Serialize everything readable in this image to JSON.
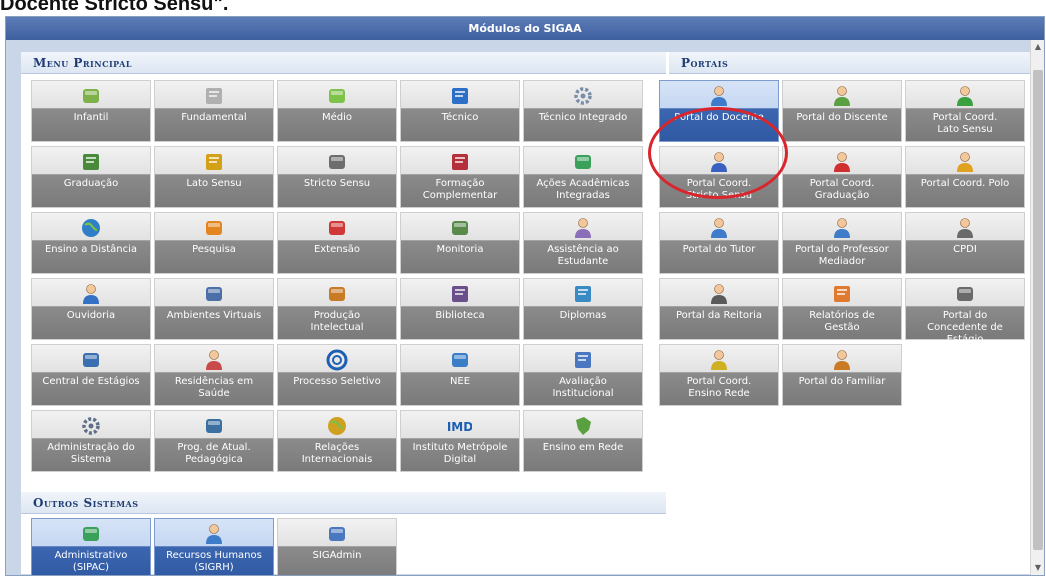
{
  "caption": "Docente Stricto Sensu\".",
  "window": {
    "title": "Módulos do SIGAA"
  },
  "sections": {
    "menu_principal": "Menu Principal",
    "portais": "Portais",
    "outros_sistemas": "Outros Sistemas"
  },
  "menu": [
    {
      "label": "Infantil",
      "icon": "pencil-cup-icon",
      "color": "#7fb14a"
    },
    {
      "label": "Fundamental",
      "icon": "notebook-icon",
      "color": "#b0b0b0"
    },
    {
      "label": "Médio",
      "icon": "crayon-icon",
      "color": "#7fc24a"
    },
    {
      "label": "Técnico",
      "icon": "book-icon",
      "color": "#2d6fc7"
    },
    {
      "label": "Técnico Integrado",
      "icon": "tools-icon",
      "color": "#7a8da8"
    },
    {
      "label": "Graduação",
      "icon": "books-icon",
      "color": "#4a8a3c"
    },
    {
      "label": "Lato Sensu",
      "icon": "folder-icon",
      "color": "#d4a017"
    },
    {
      "label": "Stricto Sensu",
      "icon": "briefcase-icon",
      "color": "#6d6d6d"
    },
    {
      "label": "Formação\nComplementar",
      "icon": "red-book-icon",
      "color": "#b3303a"
    },
    {
      "label": "Ações Acadêmicas\nIntegradas",
      "icon": "puzzle-icon",
      "color": "#3aa05a"
    },
    {
      "label": "Ensino a Distância",
      "icon": "globe-icon",
      "color": "#2e7fc8"
    },
    {
      "label": "Pesquisa",
      "icon": "flask-icon",
      "color": "#e3861f"
    },
    {
      "label": "Extensão",
      "icon": "gift-icon",
      "color": "#d03838"
    },
    {
      "label": "Monitoria",
      "icon": "easel-icon",
      "color": "#5a8a4a"
    },
    {
      "label": "Assistência ao\nEstudante",
      "icon": "student-help-icon",
      "color": "#8a6fb8"
    },
    {
      "label": "Ouvidoria",
      "icon": "person-icon",
      "color": "#3470c4"
    },
    {
      "label": "Ambientes Virtuais",
      "icon": "network-icon",
      "color": "#4c6fa8"
    },
    {
      "label": "Produção\nIntelectual",
      "icon": "author-icon",
      "color": "#c87a24"
    },
    {
      "label": "Biblioteca",
      "icon": "open-book-icon",
      "color": "#6a4f8a"
    },
    {
      "label": "Diplomas",
      "icon": "diploma-icon",
      "color": "#3a8ac4"
    },
    {
      "label": "Central de Estágios",
      "icon": "id-card-icon",
      "color": "#3a6fb0"
    },
    {
      "label": "Residências em\nSaúde",
      "icon": "doctor-icon",
      "color": "#c84a4a"
    },
    {
      "label": "Processo Seletivo",
      "icon": "c-logo-icon",
      "color": "#1e5fb3"
    },
    {
      "label": "NEE",
      "icon": "accessibility-icon",
      "color": "#3a7ec8"
    },
    {
      "label": "Avaliação\nInstitucional",
      "icon": "evaluation-icon",
      "color": "#4a78c0"
    },
    {
      "label": "Administração do\nSistema",
      "icon": "gears-icon",
      "color": "#5f6f88"
    },
    {
      "label": "Prog. de Atual.\nPedagógica",
      "icon": "presentation-icon",
      "color": "#3a6fa0"
    },
    {
      "label": "Relações\nInternacionais",
      "icon": "globe-hand-icon",
      "color": "#d0a020"
    },
    {
      "label": "Instituto Metrópole\nDigital",
      "icon": "imd-logo-icon",
      "color": "#1d5fb0",
      "text": "IMD"
    },
    {
      "label": "Ensino em Rede",
      "icon": "map-brazil-icon",
      "color": "#5aa040"
    }
  ],
  "portais": [
    {
      "label": "Portal do Docente",
      "icon": "teacher-icon",
      "color": "#3e7cc9",
      "selected": true
    },
    {
      "label": "Portal do Discente",
      "icon": "student-icon",
      "color": "#5aa040"
    },
    {
      "label": "Portal Coord.\nLato Sensu",
      "icon": "coord-lato-icon",
      "color": "#3aa040"
    },
    {
      "label": "Portal Coord.\nStricto Sensu",
      "icon": "coord-stricto-icon",
      "color": "#3a60c0"
    },
    {
      "label": "Portal Coord.\nGraduação",
      "icon": "coord-grad-icon",
      "color": "#d03030"
    },
    {
      "label": "Portal Coord. Polo",
      "icon": "coord-polo-icon",
      "color": "#e0a020"
    },
    {
      "label": "Portal do Tutor",
      "icon": "tutor-icon",
      "color": "#3e7cc9"
    },
    {
      "label": "Portal do Professor\nMediador",
      "icon": "mediator-icon",
      "color": "#3e7cc9"
    },
    {
      "label": "CPDI",
      "icon": "cpdi-icon",
      "color": "#6a6a6a"
    },
    {
      "label": "Portal da Reitoria",
      "icon": "reitoria-icon",
      "color": "#5a5a5a"
    },
    {
      "label": "Relatórios de\nGestão",
      "icon": "reports-icon",
      "color": "#e07a30"
    },
    {
      "label": "Portal do\nConcedente de\nEstágio",
      "icon": "concedente-icon",
      "color": "#6a6a6a"
    },
    {
      "label": "Portal Coord.\nEnsino Rede",
      "icon": "coord-rede-icon",
      "color": "#d0b020"
    },
    {
      "label": "Portal do Familiar",
      "icon": "family-icon",
      "color": "#c87a24"
    }
  ],
  "outros": [
    {
      "label": "Administrativo\n(SIPAC)",
      "icon": "admin-puzzle-icon",
      "color": "#3aa05a",
      "selected": true
    },
    {
      "label": "Recursos Humanos\n(SIGRH)",
      "icon": "hr-person-icon",
      "color": "#3e7cc9",
      "selected": true
    },
    {
      "label": "SIGAdmin",
      "icon": "sigadmin-icon",
      "color": "#4a78c0"
    }
  ]
}
